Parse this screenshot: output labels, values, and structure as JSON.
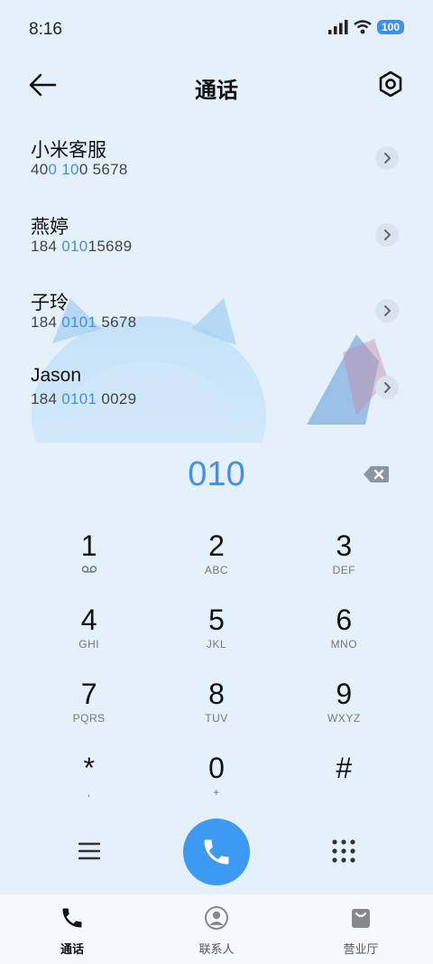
{
  "status": {
    "time": "8:16",
    "battery": "100"
  },
  "header": {
    "title": "通话"
  },
  "results": [
    {
      "name": "小米客服",
      "number_parts": [
        "40",
        "0 10",
        "0 5678"
      ]
    },
    {
      "name": "燕婷",
      "number_parts": [
        "184 ",
        "010",
        "15689"
      ]
    },
    {
      "name": "子玲",
      "number_parts": [
        "184 ",
        "0101",
        " 5678"
      ]
    },
    {
      "name": "Jason",
      "number_parts": [
        "184 ",
        "0101",
        " 0029"
      ]
    }
  ],
  "dialed": "010",
  "keypad": [
    [
      {
        "digit": "1",
        "sub": ""
      },
      {
        "digit": "2",
        "sub": "ABC"
      },
      {
        "digit": "3",
        "sub": "DEF"
      }
    ],
    [
      {
        "digit": "4",
        "sub": "GHI"
      },
      {
        "digit": "5",
        "sub": "JKL"
      },
      {
        "digit": "6",
        "sub": "MNO"
      }
    ],
    [
      {
        "digit": "7",
        "sub": "PQRS"
      },
      {
        "digit": "8",
        "sub": "TUV"
      },
      {
        "digit": "9",
        "sub": "WXYZ"
      }
    ],
    [
      {
        "digit": "*",
        "sub": ","
      },
      {
        "digit": "0",
        "sub": "+"
      },
      {
        "digit": "#",
        "sub": ""
      }
    ]
  ],
  "nav": [
    {
      "label": "通话",
      "icon": "phone-icon"
    },
    {
      "label": "联系人",
      "icon": "contact-icon"
    },
    {
      "label": "营业厅",
      "icon": "bag-icon"
    }
  ],
  "colors": {
    "accent": "#3d8ff0",
    "background": "#e4f1fb"
  }
}
